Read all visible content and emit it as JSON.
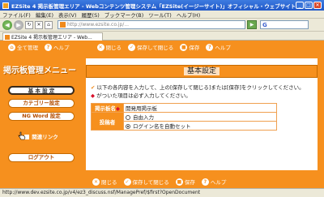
{
  "window": {
    "title": "EZSite 4 掲示板管理エリア - Webコンテンツ管理システム「EZSite(イージーサイト)」オフィシャル・ウェブサイト 掲示板 - Mozill..."
  },
  "menubar": {
    "items": [
      "ファイル(F)",
      "編集(E)",
      "表示(V)",
      "履歴(S)",
      "ブックマーク(B)",
      "ツール(T)",
      "ヘルプ(H)"
    ]
  },
  "navbar": {
    "back_symbol": "◀",
    "forward_symbol": "▶",
    "reload_symbol": "↻",
    "stop_symbol": "✕",
    "home_symbol": "⌂",
    "go_symbol": "▶",
    "url": "http://www.ezsite.co.jp/...",
    "search_g": "G",
    "search_placeholder": "Google"
  },
  "tab": {
    "title": "EZSite 4 掲示板管理エリア - Web..."
  },
  "top_toolbar": {
    "all_admin": "全て管理",
    "help": "ヘルプ",
    "close": "閉じる",
    "save_close": "保存して閉じる",
    "save": "保存",
    "help2": "ヘルプ"
  },
  "sidebar": {
    "title": "掲示板管理メニュー",
    "items": [
      {
        "label": "基 本 設 定"
      },
      {
        "label": "カテゴリー設定"
      },
      {
        "label": "NG Word 設定"
      },
      {
        "label": "関連リンク"
      },
      {
        "label": "ログアウト"
      }
    ]
  },
  "main": {
    "heading": "基本設定",
    "note1": "以下の各内容を入力して、上の[保存して閉じる]または[保存]をクリックしてください。",
    "note2": "がついた項目は必ず入力してください。",
    "form": {
      "name_label": "掲示板名",
      "name_value": "開発用掲示板",
      "poster_label": "投稿者",
      "option1": "自由入力",
      "option2": "ログイン名を自動セット"
    }
  },
  "bottom_toolbar": {
    "close": "閉じる",
    "save_close": "保存して閉じる",
    "save": "保存",
    "help": "ヘルプ"
  },
  "status": {
    "text": "http://www.dev.ezsite.co.jp/v4/ez3_discuss.nsf/ManagePref/$first?OpenDocument"
  }
}
